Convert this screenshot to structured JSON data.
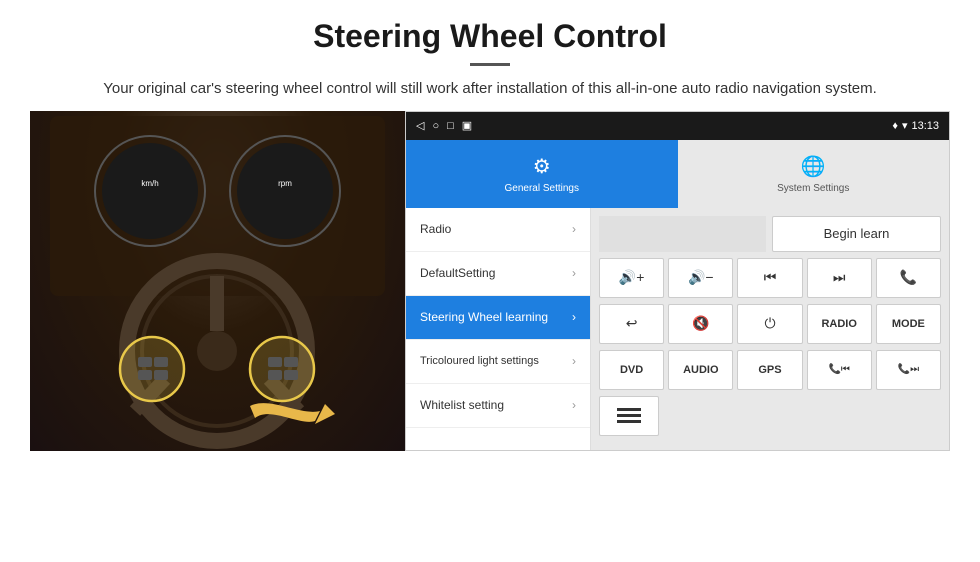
{
  "header": {
    "title": "Steering Wheel Control",
    "subtitle": "Your original car's steering wheel control will still work after installation of this all-in-one auto radio navigation system."
  },
  "status_bar": {
    "time": "13:13",
    "icons": [
      "◁",
      "○",
      "□",
      "▣"
    ]
  },
  "nav_tabs": [
    {
      "label": "General Settings",
      "active": true
    },
    {
      "label": "System Settings",
      "active": false
    }
  ],
  "menu_items": [
    {
      "label": "Radio",
      "active": false
    },
    {
      "label": "DefaultSetting",
      "active": false
    },
    {
      "label": "Steering Wheel learning",
      "active": true
    },
    {
      "label": "Tricoloured light settings",
      "active": false
    },
    {
      "label": "Whitelist setting",
      "active": false
    }
  ],
  "begin_learn_label": "Begin learn",
  "control_buttons": {
    "row1": [
      "🔊+",
      "🔊−",
      "⏮",
      "⏭",
      "📞"
    ],
    "row2": [
      "↩",
      "🔇",
      "⏻",
      "RADIO",
      "MODE"
    ],
    "row3": [
      "DVD",
      "AUDIO",
      "GPS",
      "📞⏮",
      "📞⏭"
    ]
  },
  "scan_icon": "≡"
}
